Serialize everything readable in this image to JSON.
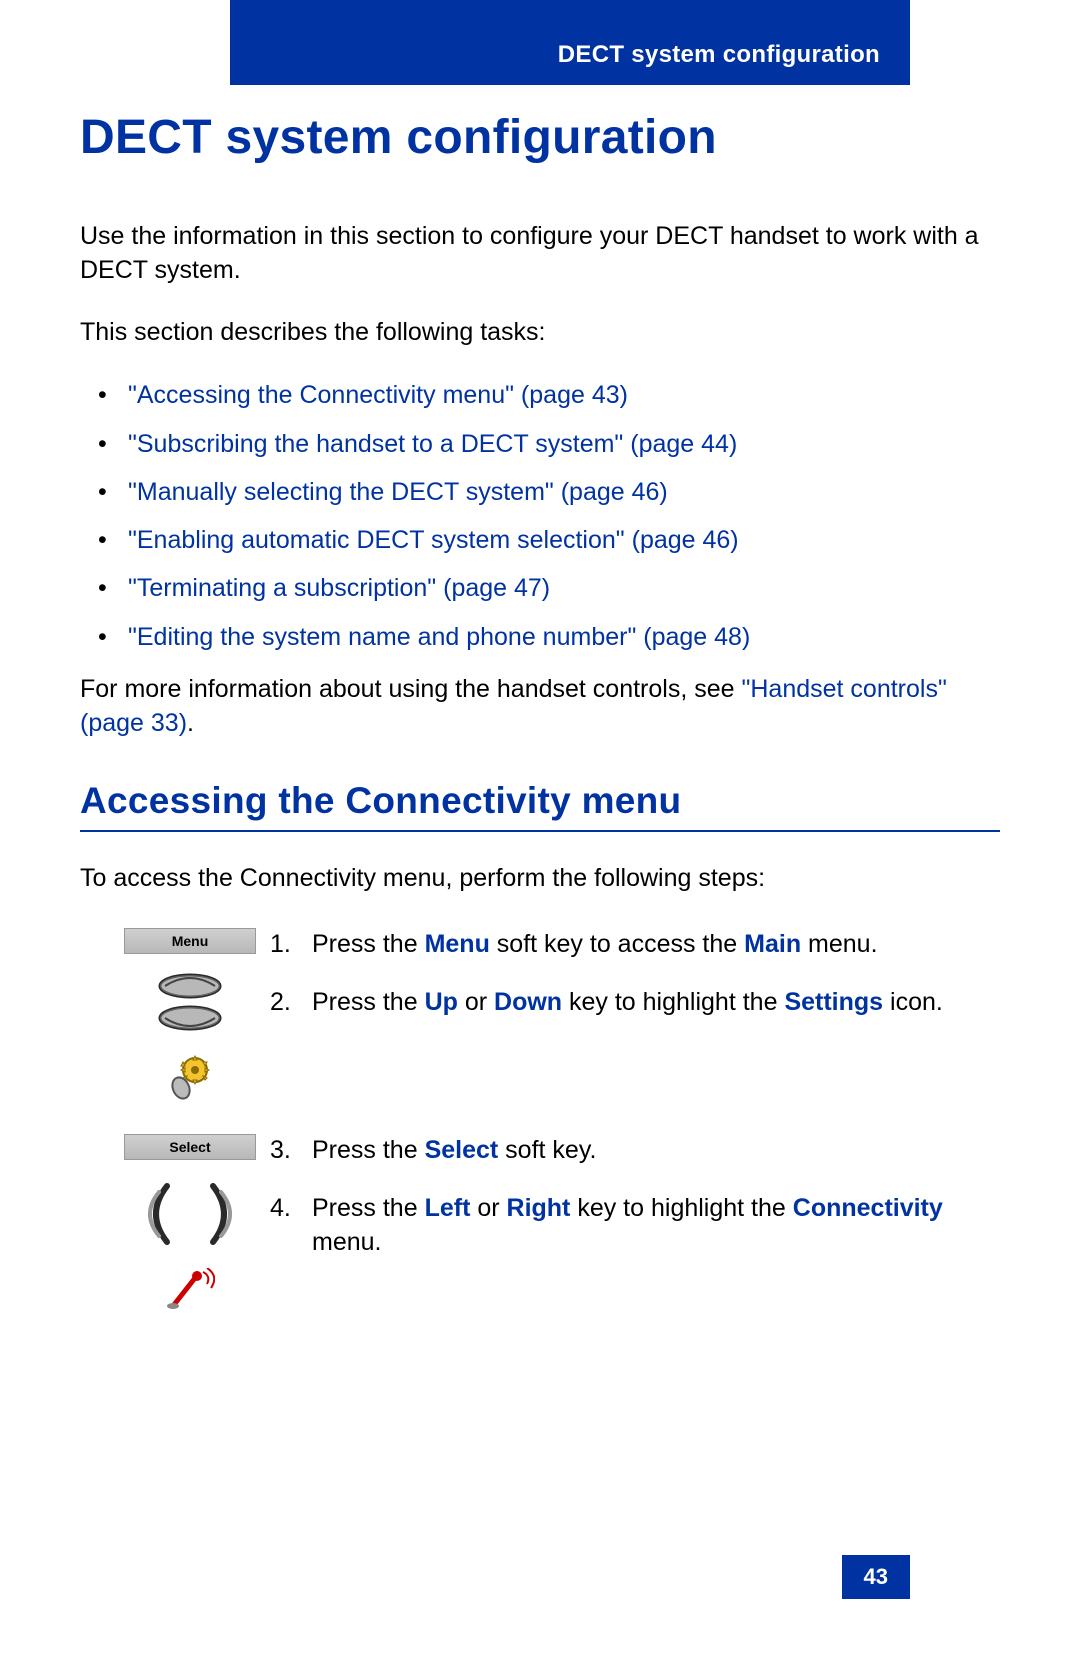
{
  "header": {
    "title": "DECT system configuration"
  },
  "title": "DECT system configuration",
  "intro1": "Use the information in this section to configure your DECT handset to work with a DECT system.",
  "intro2": "This section describes the following tasks:",
  "tasks": [
    "\"Accessing the Connectivity menu\" (page 43)",
    "\"Subscribing the handset to a DECT system\" (page 44)",
    "\"Manually selecting the DECT system\" (page 46)",
    "\"Enabling automatic DECT system selection\" (page 46)",
    "\"Terminating a subscription\" (page 47)",
    "\"Editing the system name and phone number\" (page 48)"
  ],
  "moreInfo": {
    "prefix": "For more information about using the handset controls, see ",
    "link": "\"Handset controls\" (page 33)",
    "suffix": "."
  },
  "section": {
    "heading": "Accessing the Connectivity menu",
    "intro": "To access the Connectivity menu, perform the following steps:"
  },
  "softkeys": {
    "menu": "Menu",
    "select": "Select"
  },
  "steps": {
    "s1": {
      "num": "1.",
      "a": "Press the ",
      "k1": "Menu",
      "b": " soft key to access the ",
      "k2": "Main",
      "c": " menu."
    },
    "s2": {
      "num": "2.",
      "a": "Press the ",
      "k1": "Up",
      "b": " or ",
      "k2": "Down",
      "c": " key to highlight the ",
      "k3": "Settings",
      "d": " icon."
    },
    "s3": {
      "num": "3.",
      "a": "Press the ",
      "k1": "Select",
      "b": " soft key."
    },
    "s4": {
      "num": "4.",
      "a": "Press the ",
      "k1": "Left",
      "b": " or ",
      "k2": "Right",
      "c": " key to highlight the ",
      "k3": "Connectivity",
      "d": " menu."
    }
  },
  "pageNumber": "43"
}
